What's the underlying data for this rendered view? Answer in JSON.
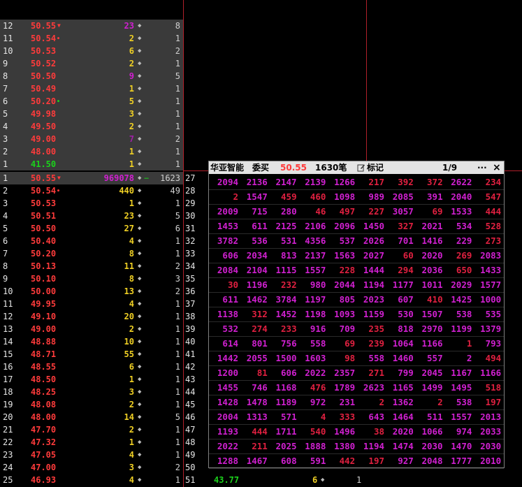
{
  "colors": {
    "red": "#ff3b3b",
    "green": "#1bd21b",
    "yellow": "#f0d024",
    "magenta": "#d020d0",
    "purple": "#a020a8",
    "white": "#e6e6e6"
  },
  "sell_levels": [
    {
      "n": "12",
      "price": "50.55",
      "mark": "down",
      "vol": "23",
      "volColor": "magenta",
      "cnt": "8"
    },
    {
      "n": "11",
      "price": "50.54",
      "mark": "dot-red",
      "vol": "2",
      "volColor": "yellow",
      "cnt": "1"
    },
    {
      "n": "10",
      "price": "50.53",
      "mark": "",
      "vol": "6",
      "volColor": "yellow",
      "cnt": "2"
    },
    {
      "n": "9",
      "price": "50.52",
      "mark": "",
      "vol": "2",
      "volColor": "yellow",
      "cnt": "1"
    },
    {
      "n": "8",
      "price": "50.50",
      "mark": "",
      "vol": "9",
      "volColor": "magenta",
      "cnt": "5"
    },
    {
      "n": "7",
      "price": "50.49",
      "mark": "",
      "vol": "1",
      "volColor": "yellow",
      "cnt": "1"
    },
    {
      "n": "6",
      "price": "50.20",
      "mark": "dot-green",
      "vol": "5",
      "volColor": "yellow",
      "cnt": "1"
    },
    {
      "n": "5",
      "price": "49.98",
      "mark": "",
      "vol": "3",
      "volColor": "yellow",
      "cnt": "1"
    },
    {
      "n": "4",
      "price": "49.50",
      "mark": "",
      "vol": "2",
      "volColor": "yellow",
      "cnt": "1"
    },
    {
      "n": "3",
      "price": "49.00",
      "mark": "",
      "vol": "7",
      "volColor": "purple",
      "cnt": "2"
    },
    {
      "n": "2",
      "price": "48.00",
      "mark": "",
      "vol": "1",
      "volColor": "yellow",
      "cnt": "1"
    },
    {
      "n": "1",
      "price": "41.50",
      "mark": "",
      "vol": "1",
      "volColor": "yellow",
      "cnt": "1",
      "priceColor": "green"
    }
  ],
  "buy_levels": [
    {
      "n": "1",
      "price": "50.55",
      "mark": "down",
      "vol": "969078",
      "volColor": "magenta",
      "cnt": "1623",
      "dash": "−"
    },
    {
      "n": "2",
      "price": "50.54",
      "mark": "dot-red",
      "vol": "440",
      "volColor": "yellow",
      "cnt": "49"
    },
    {
      "n": "3",
      "price": "50.53",
      "vol": "1",
      "volColor": "yellow",
      "cnt": "1"
    },
    {
      "n": "4",
      "price": "50.51",
      "vol": "23",
      "volColor": "yellow",
      "cnt": "5"
    },
    {
      "n": "5",
      "price": "50.50",
      "vol": "27",
      "volColor": "yellow",
      "cnt": "6"
    },
    {
      "n": "6",
      "price": "50.40",
      "vol": "4",
      "volColor": "yellow",
      "cnt": "1"
    },
    {
      "n": "7",
      "price": "50.20",
      "vol": "8",
      "volColor": "yellow",
      "cnt": "1"
    },
    {
      "n": "8",
      "price": "50.13",
      "vol": "11",
      "volColor": "yellow",
      "cnt": "2"
    },
    {
      "n": "9",
      "price": "50.10",
      "vol": "8",
      "volColor": "yellow",
      "cnt": "3"
    },
    {
      "n": "10",
      "price": "50.00",
      "vol": "13",
      "volColor": "yellow",
      "cnt": "2"
    },
    {
      "n": "11",
      "price": "49.95",
      "vol": "4",
      "volColor": "yellow",
      "cnt": "1"
    },
    {
      "n": "12",
      "price": "49.10",
      "vol": "20",
      "volColor": "yellow",
      "cnt": "1"
    },
    {
      "n": "13",
      "price": "49.00",
      "vol": "2",
      "volColor": "yellow",
      "cnt": "1"
    },
    {
      "n": "14",
      "price": "48.88",
      "vol": "10",
      "volColor": "yellow",
      "cnt": "1"
    },
    {
      "n": "15",
      "price": "48.71",
      "vol": "55",
      "volColor": "yellow",
      "cnt": "1"
    },
    {
      "n": "16",
      "price": "48.55",
      "vol": "6",
      "volColor": "yellow",
      "cnt": "1"
    },
    {
      "n": "17",
      "price": "48.50",
      "vol": "1",
      "volColor": "yellow",
      "cnt": "1"
    },
    {
      "n": "18",
      "price": "48.25",
      "vol": "3",
      "volColor": "yellow",
      "cnt": "1"
    },
    {
      "n": "19",
      "price": "48.08",
      "vol": "2",
      "volColor": "yellow",
      "cnt": "1"
    },
    {
      "n": "20",
      "price": "48.00",
      "vol": "14",
      "volColor": "yellow",
      "cnt": "5"
    },
    {
      "n": "21",
      "price": "47.70",
      "vol": "2",
      "volColor": "yellow",
      "cnt": "1"
    },
    {
      "n": "22",
      "price": "47.32",
      "vol": "1",
      "volColor": "yellow",
      "cnt": "1"
    },
    {
      "n": "23",
      "price": "47.05",
      "vol": "4",
      "volColor": "yellow",
      "cnt": "1"
    },
    {
      "n": "24",
      "price": "47.00",
      "vol": "3",
      "volColor": "yellow",
      "cnt": "2"
    },
    {
      "n": "25",
      "price": "46.93",
      "vol": "4",
      "volColor": "yellow",
      "cnt": "1"
    }
  ],
  "right_indices": [
    "27",
    "28",
    "29",
    "30",
    "31",
    "32",
    "33",
    "34",
    "35",
    "36",
    "37",
    "38",
    "39",
    "40",
    "41",
    "42",
    "43",
    "44",
    "45",
    "46",
    "47",
    "48",
    "49",
    "50",
    "51"
  ],
  "bottom_row": {
    "price": "43.77",
    "vol": "6",
    "cnt": "1"
  },
  "popup": {
    "stock": "华亚智能",
    "side": "委买",
    "price": "50.55",
    "count": "1630笔",
    "mark_label": "标记",
    "page": "1/9",
    "more": "···",
    "close": "×",
    "rows": [
      [
        "2094",
        "2136",
        "2147",
        "2139",
        "1266",
        "217",
        "392",
        "372",
        "2622",
        "234"
      ],
      [
        "2",
        "1547",
        "459",
        "460",
        "1098",
        "989",
        "2085",
        "391",
        "2040",
        "547"
      ],
      [
        "2009",
        "715",
        "280",
        "46",
        "497",
        "227",
        "3057",
        "69",
        "1533",
        "444"
      ],
      [
        "1453",
        "611",
        "2125",
        "2106",
        "2096",
        "1450",
        "327",
        "2021",
        "534",
        "528"
      ],
      [
        "3782",
        "536",
        "531",
        "4356",
        "537",
        "2026",
        "701",
        "1416",
        "229",
        "273"
      ],
      [
        "606",
        "2034",
        "813",
        "2137",
        "1563",
        "2027",
        "60",
        "2020",
        "269",
        "2083"
      ],
      [
        "2084",
        "2104",
        "1115",
        "1557",
        "228",
        "1444",
        "294",
        "2036",
        "650",
        "1433"
      ],
      [
        "30",
        "1196",
        "232",
        "980",
        "2044",
        "1194",
        "1177",
        "1011",
        "2029",
        "1577"
      ],
      [
        "611",
        "1462",
        "3784",
        "1197",
        "805",
        "2023",
        "607",
        "410",
        "1425",
        "1000"
      ],
      [
        "1138",
        "312",
        "1452",
        "1198",
        "1093",
        "1159",
        "530",
        "1507",
        "538",
        "535"
      ],
      [
        "532",
        "274",
        "233",
        "916",
        "709",
        "235",
        "818",
        "2970",
        "1199",
        "1379"
      ],
      [
        "614",
        "801",
        "756",
        "558",
        "69",
        "239",
        "1064",
        "1166",
        "1",
        "793"
      ],
      [
        "1442",
        "2055",
        "1500",
        "1603",
        "98",
        "558",
        "1460",
        "557",
        "2",
        "494"
      ],
      [
        "1200",
        "81",
        "606",
        "2022",
        "2357",
        "271",
        "799",
        "2045",
        "1167",
        "1166"
      ],
      [
        "1455",
        "746",
        "1168",
        "476",
        "1789",
        "2623",
        "1165",
        "1499",
        "1495",
        "518"
      ],
      [
        "1428",
        "1478",
        "1189",
        "972",
        "231",
        "2",
        "1362",
        "2",
        "538",
        "197"
      ],
      [
        "2004",
        "1313",
        "571",
        "4",
        "333",
        "643",
        "1464",
        "511",
        "1557",
        "2013"
      ],
      [
        "1193",
        "444",
        "1711",
        "540",
        "1496",
        "38",
        "2020",
        "1066",
        "974",
        "2033"
      ],
      [
        "2022",
        "211",
        "2025",
        "1888",
        "1380",
        "1194",
        "1474",
        "2030",
        "1470",
        "2030"
      ],
      [
        "1288",
        "1467",
        "608",
        "591",
        "442",
        "197",
        "927",
        "2048",
        "1777",
        "2010"
      ]
    ],
    "reds": [
      [
        0,
        5
      ],
      [
        0,
        6
      ],
      [
        0,
        7
      ],
      [
        0,
        9
      ],
      [
        1,
        0
      ],
      [
        1,
        2
      ],
      [
        1,
        3
      ],
      [
        1,
        9
      ],
      [
        2,
        3
      ],
      [
        2,
        4
      ],
      [
        2,
        5
      ],
      [
        2,
        7
      ],
      [
        2,
        9
      ],
      [
        3,
        6
      ],
      [
        3,
        9
      ],
      [
        4,
        9
      ],
      [
        5,
        6
      ],
      [
        5,
        8
      ],
      [
        6,
        4
      ],
      [
        6,
        6
      ],
      [
        6,
        8
      ],
      [
        7,
        0
      ],
      [
        7,
        2
      ],
      [
        8,
        7
      ],
      [
        9,
        1
      ],
      [
        10,
        1
      ],
      [
        10,
        2
      ],
      [
        10,
        5
      ],
      [
        11,
        4
      ],
      [
        11,
        5
      ],
      [
        11,
        8
      ],
      [
        12,
        4
      ],
      [
        12,
        9
      ],
      [
        13,
        1
      ],
      [
        13,
        5
      ],
      [
        14,
        3
      ],
      [
        14,
        9
      ],
      [
        15,
        5
      ],
      [
        15,
        7
      ],
      [
        15,
        9
      ],
      [
        16,
        3
      ],
      [
        16,
        4
      ],
      [
        17,
        1
      ],
      [
        17,
        3
      ],
      [
        17,
        5
      ],
      [
        18,
        1
      ],
      [
        19,
        4
      ],
      [
        19,
        5
      ]
    ]
  }
}
